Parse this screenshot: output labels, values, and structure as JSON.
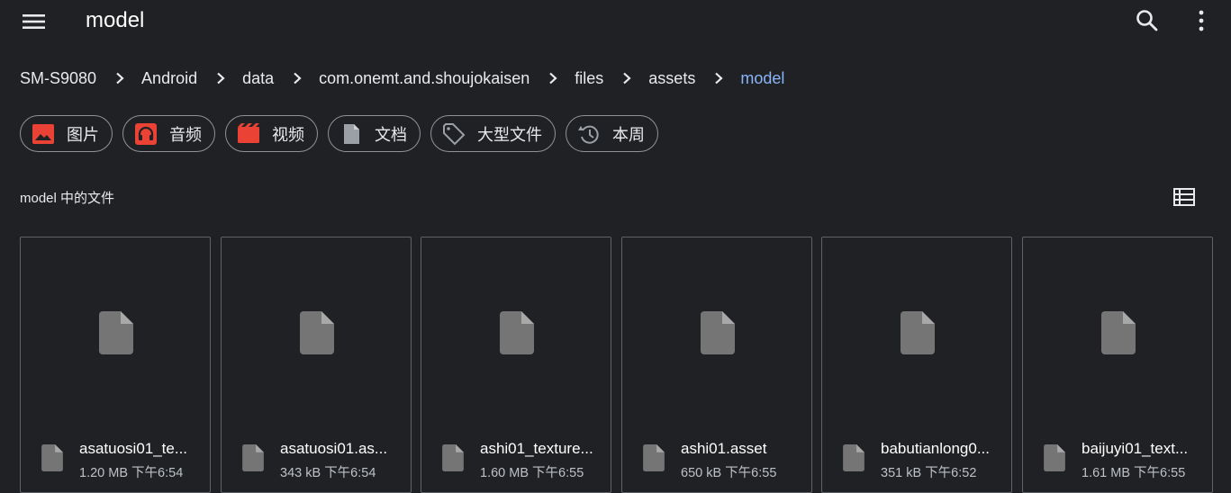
{
  "header": {
    "title": "model",
    "icons": {
      "menu": "menu-icon",
      "search": "search-icon",
      "more": "more-vert-icon"
    }
  },
  "breadcrumb": [
    {
      "label": "SM-S9080"
    },
    {
      "label": "Android"
    },
    {
      "label": "data"
    },
    {
      "label": "com.onemt.and.shoujokaisen"
    },
    {
      "label": "files"
    },
    {
      "label": "assets"
    },
    {
      "label": "model",
      "current": true
    }
  ],
  "chips": [
    {
      "label": "图片",
      "icon": "image-icon",
      "color": "#ea4335"
    },
    {
      "label": "音频",
      "icon": "headphones-icon",
      "color": "#ea4335"
    },
    {
      "label": "视频",
      "icon": "movie-icon",
      "color": "#ea4335"
    },
    {
      "label": "文档",
      "icon": "document-icon",
      "color": "#9aa0a6"
    },
    {
      "label": "大型文件",
      "icon": "tag-icon",
      "color": "#9aa0a6"
    },
    {
      "label": "本周",
      "icon": "history-icon",
      "color": "#9aa0a6"
    }
  ],
  "section": {
    "title": "model 中的文件",
    "view_toggle_icon": "list-view-icon"
  },
  "files": [
    {
      "name": "asatuosi01_te...",
      "size": "1.20 MB",
      "time": "下午6:54"
    },
    {
      "name": "asatuosi01.as...",
      "size": "343 kB",
      "time": "下午6:54"
    },
    {
      "name": "ashi01_texture...",
      "size": "1.60 MB",
      "time": "下午6:55"
    },
    {
      "name": "ashi01.asset",
      "size": "650 kB",
      "time": "下午6:55"
    },
    {
      "name": "babutianlong0...",
      "size": "351 kB",
      "time": "下午6:52"
    },
    {
      "name": "baijuyi01_text...",
      "size": "1.61 MB",
      "time": "下午6:55"
    }
  ],
  "colors": {
    "background": "#202124",
    "accent": "#8ab4f8",
    "chip_border": "#8f9297",
    "file_icon": "#757575"
  }
}
